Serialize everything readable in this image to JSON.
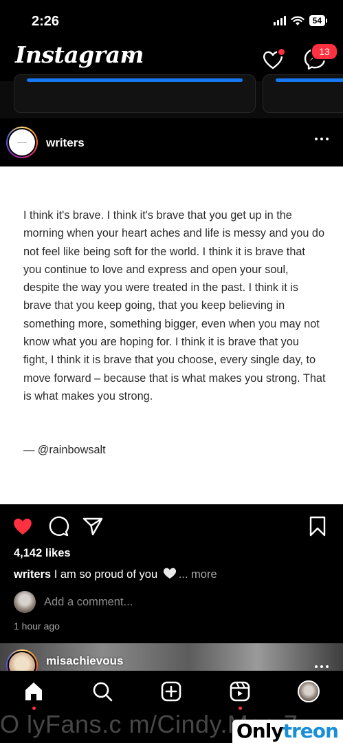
{
  "status_bar": {
    "time": "2:26",
    "battery": "54"
  },
  "header": {
    "logo": "Instagram",
    "messages_badge": "13"
  },
  "post": {
    "username": "writers",
    "quote": "I think it's brave. I think it's brave that you get up in the morning when your heart aches and life is messy and you do not feel like being soft for the world. I think it is brave that you continue to love and express and open your soul, despite the way you were treated in the past. I think it is brave that you keep going, that you keep believing in something more, something bigger, even when you may not know what you are hoping for. I think it is brave that you fight, I think it is brave that you choose, every single day, to move forward – because that is what makes you strong. That is what makes you strong.",
    "quote_author": "— @rainbowsalt",
    "liked": true,
    "likes": "4,142 likes",
    "caption_user": "writers",
    "caption_text": "I am so proud of you",
    "caption_more": "... more",
    "comment_placeholder": "Add a comment...",
    "time_ago": "1 hour ago"
  },
  "next_post": {
    "username": "misachievous"
  },
  "watermark": {
    "text": "O lyFans.c m/Cindy.Mae 7",
    "logo_main": "Only",
    "logo_accent": "treon"
  },
  "colors": {
    "like_red": "#ff3040",
    "button_blue": "#1877f2"
  },
  "icons": {
    "header": [
      "chevron-down-icon",
      "heart-icon",
      "messenger-icon"
    ],
    "actions": [
      "heart-filled-icon",
      "comment-icon",
      "share-icon",
      "bookmark-icon"
    ],
    "nav": [
      "home-icon",
      "search-icon",
      "create-icon",
      "reels-icon",
      "profile-avatar"
    ]
  }
}
